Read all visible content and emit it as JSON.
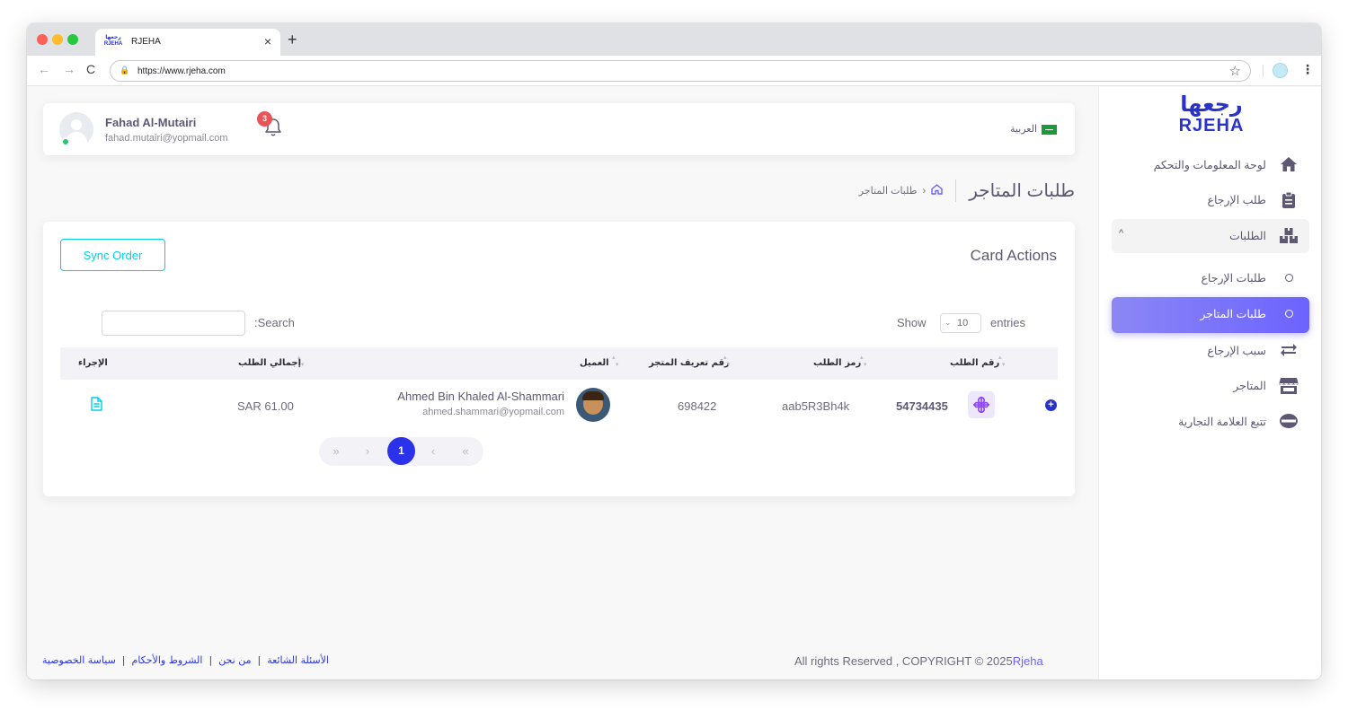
{
  "browser": {
    "tab_title": "RJEHA",
    "tab_favicon_ar": "رجعها",
    "tab_favicon_en": "RJEHA",
    "url": "https://www.rjeha.com",
    "nav_back": "←",
    "nav_forward": "→",
    "nav_reload": "C",
    "lock": "🔒",
    "star": "☆",
    "close_tab": "×",
    "new_tab": "+",
    "menu": "⋮"
  },
  "sidebar": {
    "brand_ar": "رجعها",
    "brand_en": "RJEHA",
    "items": [
      {
        "label": "لوحة المعلومات والتحكم",
        "icon": "home-icon"
      },
      {
        "label": "طلب الإرجاع",
        "icon": "clipboard-icon"
      },
      {
        "label": "الطلبات",
        "icon": "boxes-icon",
        "caret": "^"
      },
      {
        "label": "طلبات الإرجاع",
        "icon": "circle-icon"
      },
      {
        "label": "طلبات المتاجر",
        "icon": "circle-icon",
        "active": true
      },
      {
        "label": "سبب الإرجاع",
        "icon": "exchange-icon"
      },
      {
        "label": "المتاجر",
        "icon": "store-icon"
      },
      {
        "label": "تتبع العلامة التجارية",
        "icon": "tracking-icon"
      }
    ]
  },
  "header": {
    "user_name": "Fahad Al-Mutairi",
    "user_email": "fahad.mutairi@yopmail.com",
    "notification_count": "3",
    "language": "العربية"
  },
  "breadcrumb": {
    "title": "طلبات المتاجر",
    "separator": "‹",
    "current": "طلبات المتاجر"
  },
  "card": {
    "title": "Card Actions",
    "sync_button": "Sync Order",
    "search_label": ":Search",
    "search_value": "",
    "show_label": "Show",
    "entries_value": "10",
    "entries_label": "entries",
    "columns": {
      "order_number": "رقم الطلب",
      "order_code": "رمز الطلب",
      "store_id": "رقم تعريف المتجر",
      "customer": "العميل",
      "total": "إجمالي الطلب",
      "action": "الإجراء"
    },
    "rows": [
      {
        "expand": "+",
        "order_number": "54734435",
        "order_code": "aab5R3Bh4k",
        "store_id": "698422",
        "customer_name": "Ahmed Bin Khaled Al-Shammari",
        "customer_email": "ahmed.shammari@yopmail.com",
        "total": "SAR 61.00"
      }
    ],
    "pagination": {
      "first": "«",
      "prev": "‹",
      "current": "1",
      "next": "›",
      "last": "»"
    }
  },
  "footer": {
    "copyright": "All rights Reserved , COPYRIGHT © 2025",
    "brand": "Rjeha",
    "links": [
      "الأسئلة الشائعة",
      "من نحن",
      "الشروط والأحكام",
      "سياسة الخصوصية"
    ],
    "separator": "|"
  },
  "colors": {
    "primary": "#6c63ff",
    "brand_blue": "#2a33c9",
    "accent_cyan": "#00cfe8",
    "danger": "#ea5455",
    "success": "#28c76f"
  }
}
